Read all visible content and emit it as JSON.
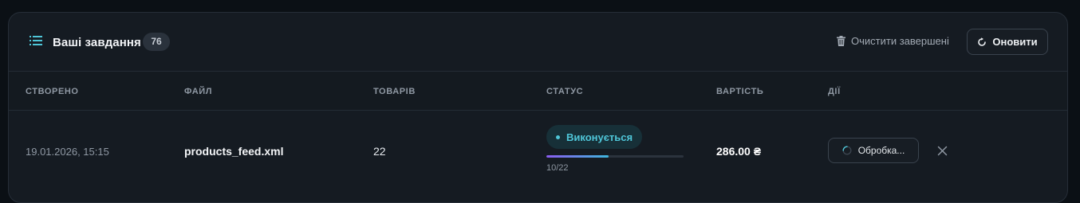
{
  "header": {
    "title": "Ваші завдання",
    "count": "76",
    "clear_label": "Очистити завершені",
    "refresh_label": "Оновити"
  },
  "table": {
    "columns": [
      "СТВОРЕНО",
      "ФАЙЛ",
      "ТОВАРІВ",
      "СТАТУС",
      "ВАРТІСТЬ",
      "ДІЇ"
    ],
    "rows": [
      {
        "created": "19.01.2026, 15:15",
        "file": "products_feed.xml",
        "items": "22",
        "status": "Виконується",
        "progress_done": 10,
        "progress_total": 22,
        "progress_text": "10/22",
        "cost": "286.00 ₴",
        "action_label": "Обробка..."
      }
    ]
  },
  "colors": {
    "accent": "#4fc6d8",
    "progress_start": "#8a5cf0",
    "progress_end": "#3fb6dd",
    "card_bg": "#151b22"
  },
  "icons": {
    "title": "list-icon",
    "clear": "trash-icon",
    "refresh": "refresh-icon",
    "processing": "spinner-icon",
    "dismiss": "close-icon"
  }
}
